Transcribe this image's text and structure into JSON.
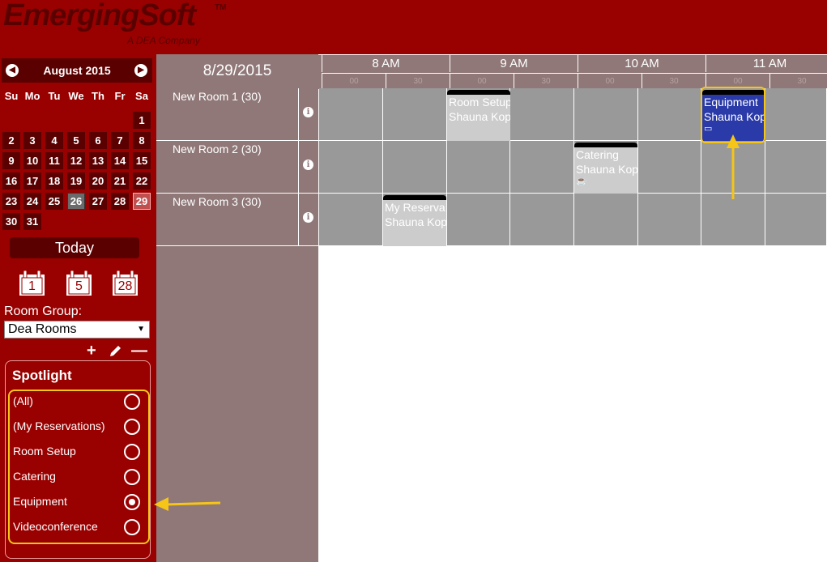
{
  "app": {
    "logo": "EmergingSoft",
    "logo_tm": "TM",
    "tagline": "A DEA Company"
  },
  "calendar": {
    "month_label": "August 2015",
    "prev_icon": "chevron-left-icon",
    "next_icon": "chevron-right-icon",
    "dow": [
      "Su",
      "Mo",
      "Tu",
      "We",
      "Th",
      "Fr",
      "Sa"
    ],
    "days": [
      "1",
      "2",
      "3",
      "4",
      "5",
      "6",
      "7",
      "8",
      "9",
      "10",
      "11",
      "12",
      "13",
      "14",
      "15",
      "16",
      "17",
      "18",
      "19",
      "20",
      "21",
      "22",
      "23",
      "24",
      "25",
      "26",
      "27",
      "28",
      "29",
      "30",
      "31"
    ],
    "today_day": "26",
    "selected_day": "29"
  },
  "today_button": "Today",
  "view_icons": [
    "1",
    "5",
    "28"
  ],
  "room_group": {
    "label": "Room Group:",
    "value": "Dea Rooms"
  },
  "spotlight": {
    "title": "Spotlight",
    "options": [
      "(All)",
      "(My Reservations)",
      "Room Setup",
      "Catering",
      "Equipment",
      "Videoconference"
    ],
    "selected": "Equipment"
  },
  "schedule": {
    "date": "8/29/2015",
    "hours": [
      "8 AM",
      "9 AM",
      "10 AM",
      "11 AM"
    ],
    "sub_labels": [
      "00",
      "30",
      "00",
      "30",
      "00",
      "30",
      "00",
      "30"
    ],
    "rooms": [
      "New Room 1 (30)",
      "New Room 2 (30)",
      "New Room 3 (30)"
    ],
    "reservations": [
      {
        "title": "Room Setup",
        "person": "Shauna Kop",
        "type": "room-setup"
      },
      {
        "title": "Equipment",
        "person": "Shauna Kop",
        "type": "equipment",
        "icon": "monitor-icon"
      },
      {
        "title": "Catering",
        "person": "Shauna Kop",
        "type": "catering",
        "icon": "coffee-cup-icon"
      },
      {
        "title": "My Reserva",
        "person": "Shauna Kop",
        "type": "my-reservation"
      }
    ]
  },
  "colors": {
    "brand": "#990000",
    "dark": "#5a0000",
    "highlight": "#f5c518",
    "equipment": "#2a3aa8"
  }
}
